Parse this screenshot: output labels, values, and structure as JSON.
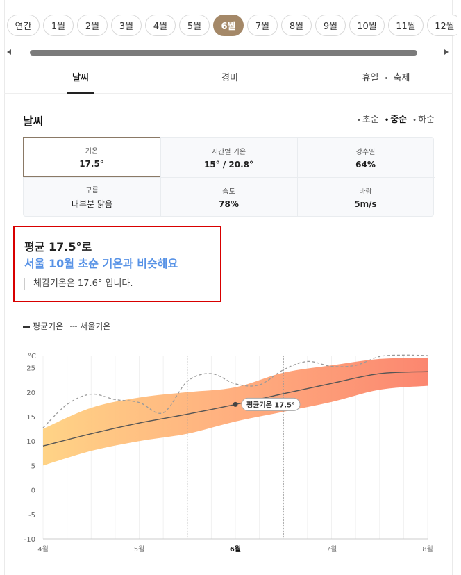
{
  "months": [
    {
      "label": "연간",
      "w": 47
    },
    {
      "label": "1월",
      "w": 44
    },
    {
      "label": "2월",
      "w": 44
    },
    {
      "label": "3월",
      "w": 44
    },
    {
      "label": "4월",
      "w": 44
    },
    {
      "label": "5월",
      "w": 44
    },
    {
      "label": "6월",
      "w": 44,
      "active": true
    },
    {
      "label": "7월",
      "w": 44
    },
    {
      "label": "8월",
      "w": 44
    },
    {
      "label": "9월",
      "w": 44
    },
    {
      "label": "10월",
      "w": 51
    },
    {
      "label": "11월",
      "w": 51
    },
    {
      "label": "12월",
      "w": 51
    }
  ],
  "tabs": {
    "weather": "날씨",
    "cost": "경비",
    "holiday": "휴일",
    "festival": "축제"
  },
  "section": {
    "title": "날씨",
    "periods": [
      "초순",
      "중순",
      "하순"
    ],
    "selected_period": "중순"
  },
  "stats": {
    "temp": {
      "label": "기온",
      "value": "17.5°"
    },
    "hourly": {
      "label": "시간별 기온",
      "value": "15° / 20.8°"
    },
    "rain": {
      "label": "강수일",
      "value": "64%"
    },
    "cloud": {
      "label": "구름",
      "value": "대부분 맑음"
    },
    "humidity": {
      "label": "습도",
      "value": "78%"
    },
    "wind": {
      "label": "바람",
      "value": "5m/s"
    }
  },
  "summary": {
    "main": "평균 17.5°로",
    "sub": "서울 10월 초순 기온과 비슷해요",
    "note": "체감기온은 17.6° 입니다."
  },
  "legend": {
    "avg": "평균기온",
    "seoul": "서울기온"
  },
  "colors": {
    "accent": "#a48868",
    "highlight_blue": "#5792e6",
    "annotation_border": "#d80000"
  },
  "chart_data": {
    "type": "area",
    "unit": "°C",
    "ylim": [
      -10,
      27.5
    ],
    "yticks": [
      25,
      20,
      15,
      10,
      5,
      0,
      -5,
      -10
    ],
    "xlim": [
      0,
      4
    ],
    "xticks": [
      {
        "x": 0,
        "label": "4월"
      },
      {
        "x": 1,
        "label": "5월"
      },
      {
        "x": 2,
        "label": "6월",
        "bold": true
      },
      {
        "x": 3,
        "label": "7월"
      },
      {
        "x": 4,
        "label": "8월"
      }
    ],
    "selected_range": [
      1.5,
      2.5
    ],
    "tooltip": {
      "x": 2,
      "y": 17.5,
      "label": "평균기온 17.5°"
    },
    "series": [
      {
        "name": "평균기온",
        "x": [
          0,
          0.5,
          1,
          1.5,
          2,
          2.5,
          3,
          3.5,
          4
        ],
        "y": [
          9.0,
          11.5,
          13.7,
          15.5,
          17.5,
          19.7,
          21.8,
          23.8,
          24.2
        ]
      },
      {
        "name": "range_low",
        "x": [
          0,
          0.5,
          1,
          1.5,
          2,
          2.5,
          3,
          3.5,
          4
        ],
        "y": [
          5.0,
          8.0,
          10.0,
          11.5,
          14.0,
          16.0,
          18.0,
          20.5,
          21.3
        ]
      },
      {
        "name": "range_high",
        "x": [
          0,
          0.5,
          1,
          1.5,
          2,
          2.5,
          3,
          3.5,
          4
        ],
        "y": [
          12.5,
          16.8,
          18.9,
          20.0,
          21.0,
          24.0,
          25.5,
          26.8,
          27.0
        ]
      },
      {
        "name": "서울기온",
        "x": [
          0,
          0.25,
          0.5,
          0.75,
          1,
          1.25,
          1.5,
          1.75,
          2,
          2.25,
          2.5,
          2.75,
          3,
          3.25,
          3.5,
          3.75,
          4
        ],
        "y": [
          12.7,
          17.5,
          19.6,
          18.5,
          17.9,
          15.8,
          22.2,
          23.8,
          21.7,
          21.5,
          24.6,
          26.3,
          25.3,
          25.5,
          27.3,
          27.6,
          27.5
        ]
      }
    ]
  }
}
